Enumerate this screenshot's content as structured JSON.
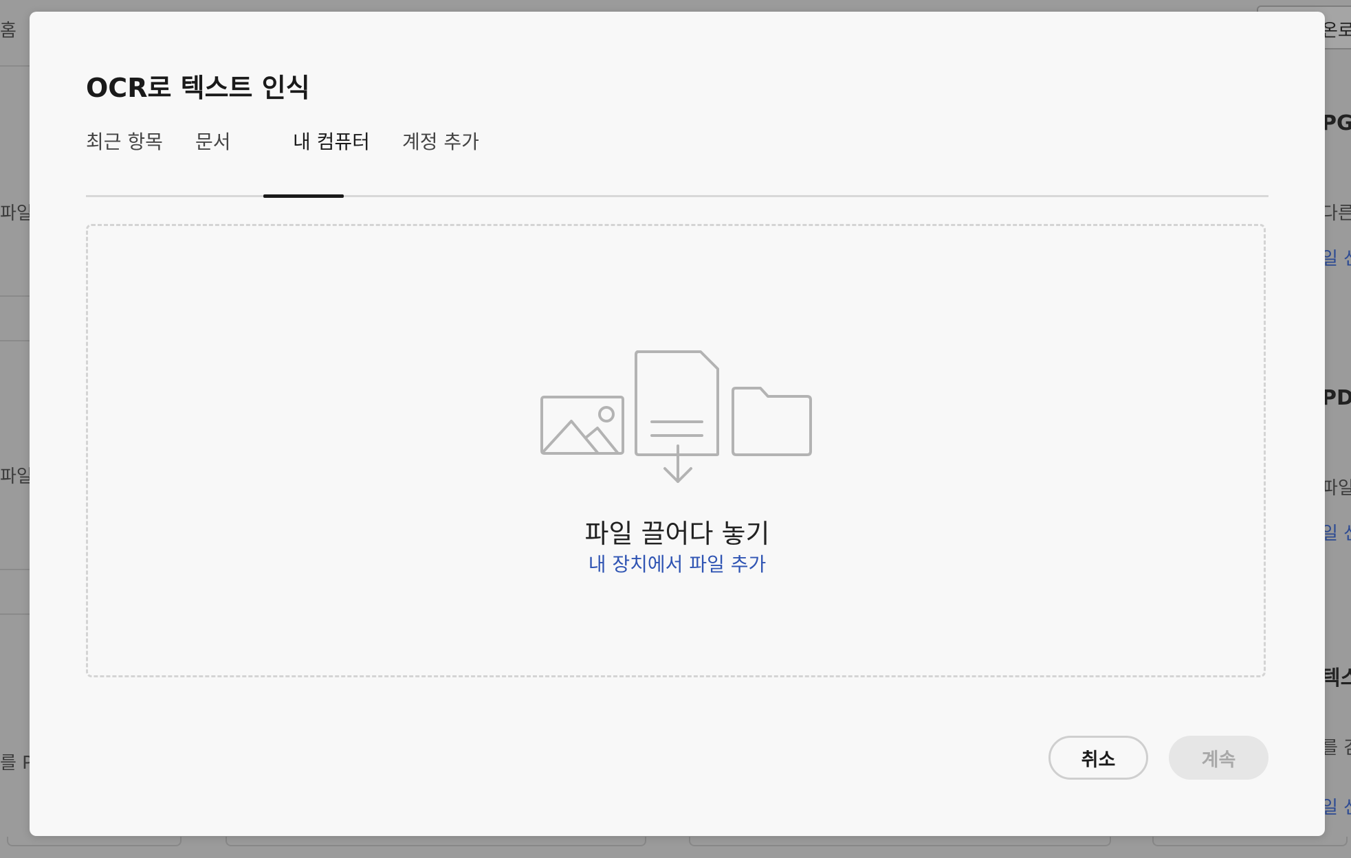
{
  "background": {
    "left_texts": [
      "홈",
      "파일로",
      "파일을",
      "를 P"
    ],
    "right_texts": {
      "top_button": "온로",
      "heading1": "PG",
      "desc1": "다른",
      "link1": "일 선",
      "heading2": "PD",
      "desc2": "파일",
      "link2": "일 선",
      "heading3": "텍스",
      "desc3": "를 검",
      "link3": "일 선"
    }
  },
  "modal": {
    "title": "OCR로 텍스트 인식",
    "tabs": [
      {
        "label": "최근 항목",
        "active": false
      },
      {
        "label": "문서",
        "active": false
      },
      {
        "label": "내 컴퓨터",
        "active": true
      },
      {
        "label": "계정 추가",
        "active": false
      }
    ],
    "dropzone": {
      "title": "파일 끌어다 놓기",
      "link": "내 장치에서 파일 추가",
      "icons": [
        "image-icon",
        "document-download-icon",
        "folder-icon"
      ]
    },
    "buttons": {
      "cancel": "취소",
      "continue": "계속",
      "continue_disabled": true
    }
  },
  "colors": {
    "modal_bg": "#f8f8f8",
    "link": "#2f54b3",
    "overlay": "#9b9b9b",
    "icon_gray": "#b3b3b3"
  }
}
